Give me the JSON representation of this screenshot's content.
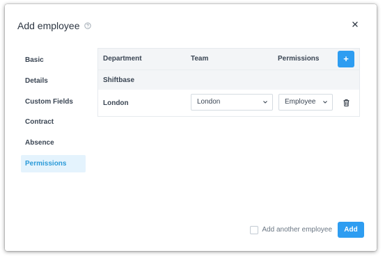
{
  "dialog": {
    "title": "Add employee",
    "help_icon": "question-circle-icon",
    "close_icon": "close-icon"
  },
  "sidebar": {
    "items": [
      {
        "label": "Basic",
        "active": false
      },
      {
        "label": "Details",
        "active": false
      },
      {
        "label": "Custom Fields",
        "active": false
      },
      {
        "label": "Contract",
        "active": false
      },
      {
        "label": "Absence",
        "active": false
      },
      {
        "label": "Permissions",
        "active": true
      }
    ]
  },
  "table": {
    "headers": {
      "department": "Department",
      "team": "Team",
      "permissions": "Permissions"
    },
    "add_button_label": "+",
    "group": "Shiftbase",
    "row": {
      "department": "London",
      "team_select": "London",
      "permission_select": "Employee",
      "delete_icon": "trash-icon"
    }
  },
  "footer": {
    "checkbox_label": "Add another employee",
    "checkbox_checked": false,
    "add_button_label": "Add"
  },
  "colors": {
    "accent": "#2e9df1",
    "active_bg": "#e4f3fd",
    "active_text": "#2b9ad8",
    "header_bg": "#f3f5f7"
  }
}
